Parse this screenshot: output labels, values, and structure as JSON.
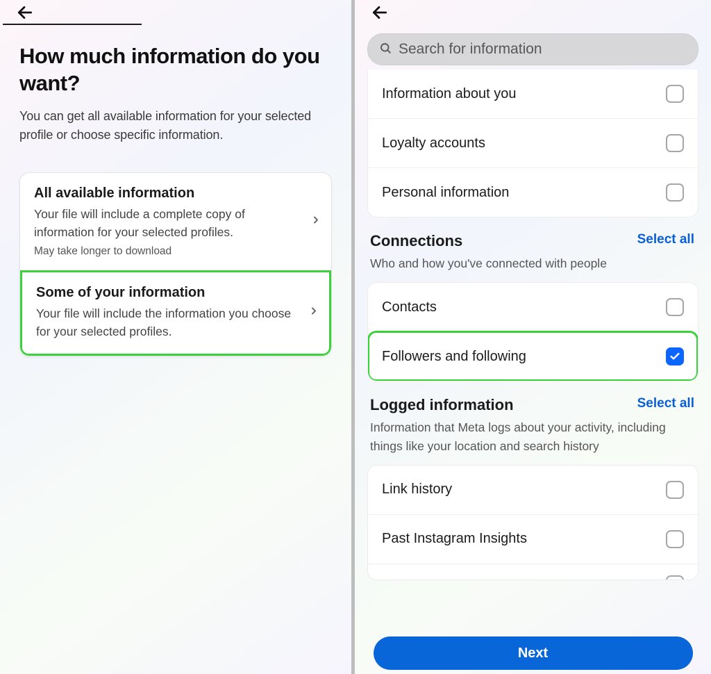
{
  "left": {
    "title": "How much information do you want?",
    "subtitle": "You can get all available information for your selected profile or choose specific information.",
    "options": [
      {
        "title": "All available information",
        "desc": "Your file will include a complete copy of information for your selected profiles.",
        "note": "May take longer to download",
        "highlighted": false
      },
      {
        "title": "Some of your information",
        "desc": "Your file will include the information you choose for your selected profiles.",
        "note": "",
        "highlighted": true
      }
    ]
  },
  "right": {
    "search_placeholder": "Search for information",
    "top_items": [
      {
        "label": "Information about you",
        "checked": false
      },
      {
        "label": "Loyalty accounts",
        "checked": false
      },
      {
        "label": "Personal information",
        "checked": false
      }
    ],
    "sections": [
      {
        "title": "Connections",
        "select_all": "Select all",
        "desc": "Who and how you've connected with people",
        "items": [
          {
            "label": "Contacts",
            "checked": false,
            "highlighted": false
          },
          {
            "label": "Followers and following",
            "checked": true,
            "highlighted": true
          }
        ]
      },
      {
        "title": "Logged information",
        "select_all": "Select all",
        "desc": "Information that Meta logs about your activity, including things like your location and search history",
        "items": [
          {
            "label": "Link history",
            "checked": false,
            "highlighted": false
          },
          {
            "label": "Past Instagram Insights",
            "checked": false,
            "highlighted": false
          }
        ]
      }
    ],
    "next_label": "Next"
  }
}
